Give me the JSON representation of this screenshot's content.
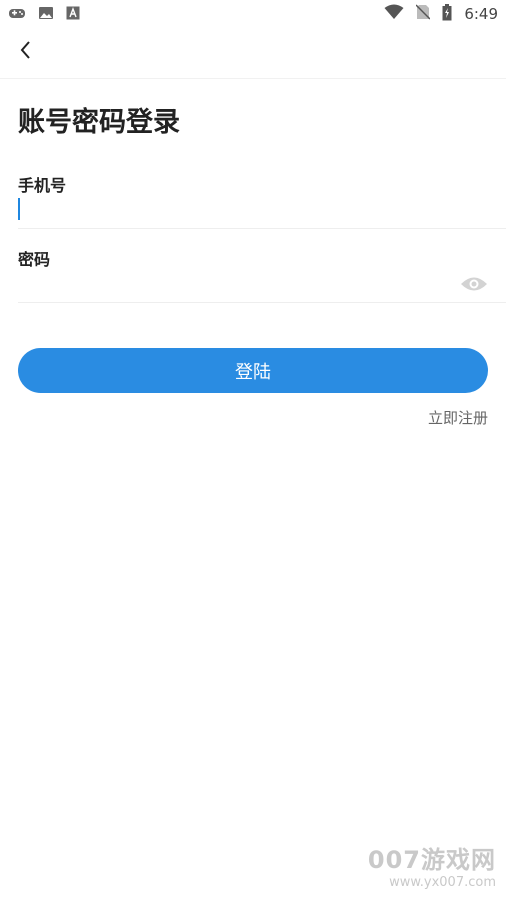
{
  "status_bar": {
    "time": "6:49",
    "left_icons": [
      "gamepad-icon",
      "image-icon",
      "font-a-icon"
    ],
    "right_icons": [
      "wifi-icon",
      "no-sim-icon",
      "battery-icon"
    ]
  },
  "nav": {
    "back_icon": "chevron-left-icon"
  },
  "page": {
    "title": "账号密码登录"
  },
  "form": {
    "phone": {
      "label": "手机号",
      "value": "",
      "placeholder": ""
    },
    "password": {
      "label": "密码",
      "value": "",
      "placeholder": "",
      "toggle_icon": "eye-icon"
    }
  },
  "actions": {
    "login_label": "登陆",
    "register_label": "立即注册"
  },
  "watermark": {
    "brand": "007游戏网",
    "url": "www.yx007.com"
  },
  "colors": {
    "accent": "#2a8ce2",
    "caret": "#1f87e0",
    "divider": "#eeeeee",
    "muted_text": "#666666"
  }
}
